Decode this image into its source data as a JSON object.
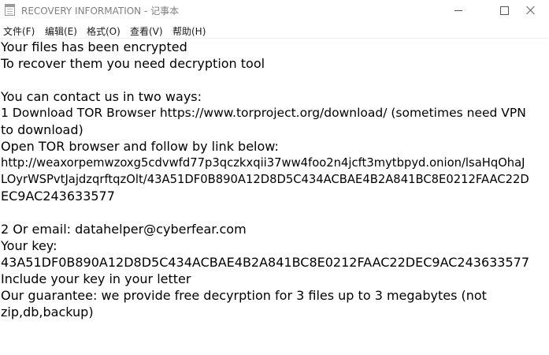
{
  "window": {
    "title": "RECOVERY INFORMATION - 记事本",
    "app_icon": "notepad-icon",
    "controls": [
      "minimize-icon",
      "maximize-icon",
      "close-icon"
    ]
  },
  "menu": [
    "文件(F)",
    "编辑(E)",
    "格式(O)",
    "查看(V)",
    "帮助(H)"
  ],
  "document": {
    "lines": [
      "Your files has been encrypted",
      "To recover them you need decryption tool",
      "",
      "You can contact us in two ways:",
      "1 Download TOR Browser https://www.torproject.org/download/ (sometimes need VPN",
      "to download)",
      "Open TOR browser and follow by link below:",
      "http://weaxorpemwzoxg5cdvwfd77p3qczkxqii37ww4foo2n4jcft3mytbpyd.onion/lsaHqOhaJ",
      "LOyrWSPvtJajdzqrftqzOlt/43A51DF0B890A12D8D5C434ACBAE4B2A841BC8E0212FAAC22D",
      "EC9AC243633577",
      "",
      "2 Or email: datahelper@cyberfear.com",
      "Your key:",
      "43A51DF0B890A12D8D5C434ACBAE4B2A841BC8E0212FAAC22DEC9AC243633577",
      "Include your key in your letter",
      "Our guarantee: we provide free decyrption for 3 files up to 3 megabytes (not",
      "zip,db,backup)"
    ]
  }
}
